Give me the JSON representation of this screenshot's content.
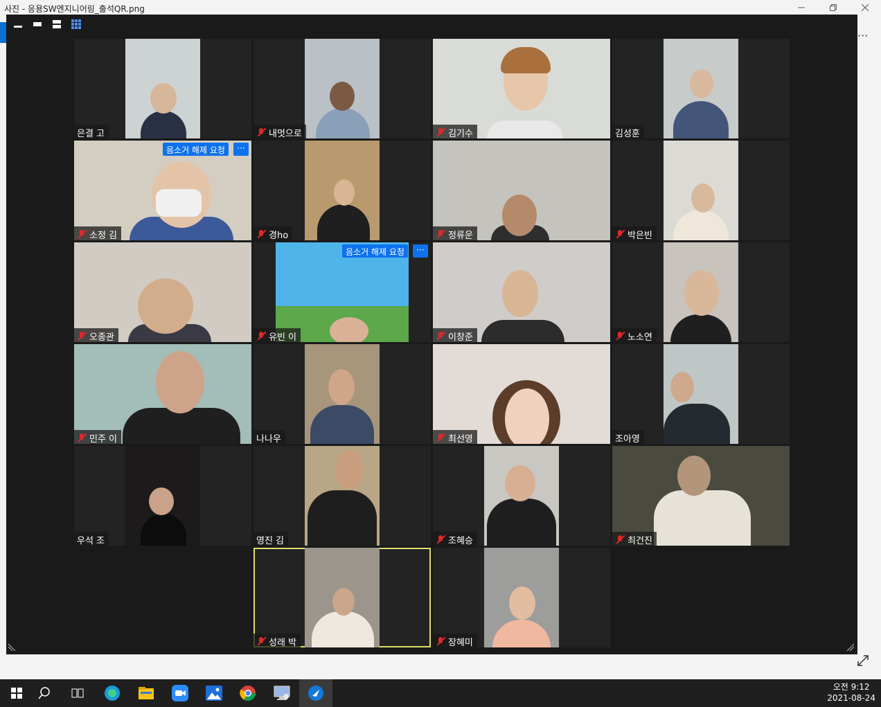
{
  "photos": {
    "title": "사진 - 응용SW엔지니어링_출석QR.png",
    "more_label": "···"
  },
  "zoom": {
    "view_buttons": [
      "minimize-view",
      "strip-view",
      "speaker-view",
      "gallery-view"
    ],
    "unmute_request_label": "음소거 해제 요청",
    "more_label": "···",
    "participants": [
      {
        "name": "은결 고",
        "muted": false
      },
      {
        "name": "내멋으로",
        "muted": true
      },
      {
        "name": "김기수",
        "muted": true
      },
      {
        "name": "김성훈",
        "muted": false
      },
      {
        "name": "소정 김",
        "muted": true,
        "unmute_request": true
      },
      {
        "name": "경ho",
        "muted": true
      },
      {
        "name": "정류운",
        "muted": true
      },
      {
        "name": "박은빈",
        "muted": true
      },
      {
        "name": "오종관",
        "muted": true
      },
      {
        "name": "유빈 이",
        "muted": true,
        "unmute_request": true
      },
      {
        "name": "이창준",
        "muted": true
      },
      {
        "name": "노소연",
        "muted": true
      },
      {
        "name": "민주 이",
        "muted": true
      },
      {
        "name": "나나우",
        "muted": false
      },
      {
        "name": "최선영",
        "muted": true
      },
      {
        "name": "조아영",
        "muted": false
      },
      {
        "name": "우석 조",
        "muted": false
      },
      {
        "name": "영진 김",
        "muted": false
      },
      {
        "name": "조혜승",
        "muted": true
      },
      {
        "name": "최건진",
        "muted": true
      },
      {
        "name": "성래 박",
        "muted": true,
        "active_speaker": true
      },
      {
        "name": "장혜미",
        "muted": true
      }
    ]
  },
  "taskbar": {
    "apps": [
      "start-icon",
      "search-icon",
      "task-view-icon",
      "edge-icon",
      "file-explorer-icon",
      "zoom-icon",
      "photos-icon",
      "chrome-icon",
      "remote-desktop-icon",
      "media-app-icon"
    ],
    "clock": {
      "time": "오전 9:12",
      "date": "2021-08-24"
    }
  },
  "colors": {
    "zoom_bg": "#1a1a1a",
    "tile_bg": "#232323",
    "unmute_blue": "#0e72ed",
    "muted_red": "#e02828",
    "active_speaker": "#dede6a",
    "taskbar_bg": "#1f1f1f"
  }
}
